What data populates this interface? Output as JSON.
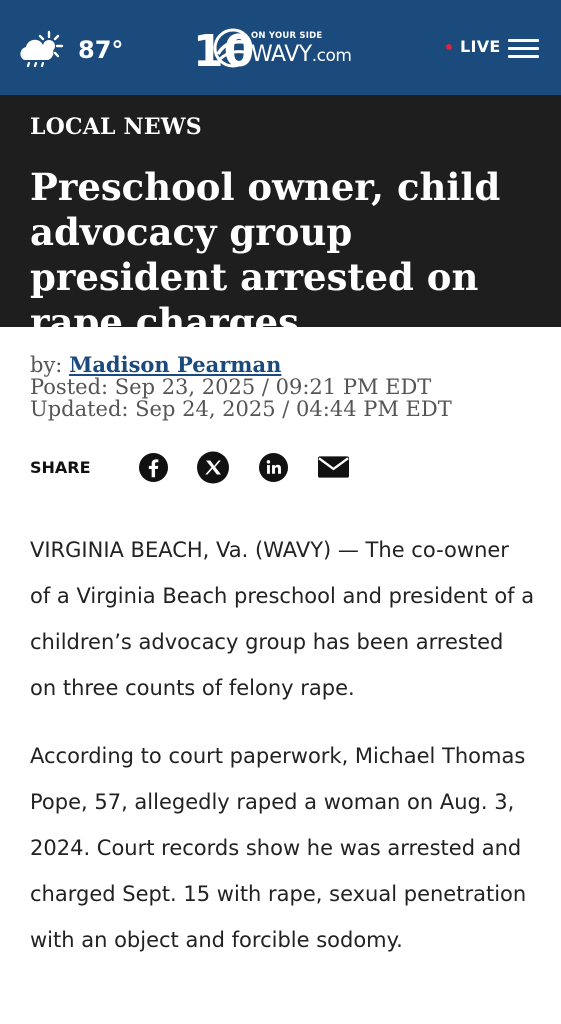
{
  "header": {
    "temperature": "87°",
    "weather_icon": "partly-cloudy-icon",
    "logo": {
      "tagline": "ON YOUR SIDE",
      "brand": "WAVY",
      "suffix": ".com",
      "channel_number": "10"
    },
    "live_label": "LIVE",
    "menu_icon": "hamburger-menu-icon"
  },
  "article": {
    "section": "LOCAL NEWS",
    "headline": "Preschool owner, child advocacy group president arrested on rape charges",
    "byline_prefix": "by:",
    "author": "Madison Pearman",
    "posted": "Posted: Sep 23, 2025 / 09:21 PM EDT",
    "updated": "Updated: Sep 24, 2025 / 04:44 PM EDT",
    "share_label": "SHARE",
    "share_targets": [
      "facebook-icon",
      "x-icon",
      "linkedin-icon",
      "email-icon"
    ],
    "paragraphs": [
      "VIRGINIA BEACH, Va. (WAVY) — The co-owner of a Virginia Beach preschool and president of a children’s advocacy group has been arrested on three counts of felony rape.",
      "According to court paperwork, Michael Thomas Pope, 57, allegedly raped a woman on Aug. 3, 2024. Court records show he was arrested and charged Sept. 15 with rape, sexual penetration with an object and forcible sodomy."
    ]
  },
  "colors": {
    "topbar": "#1b4a7c",
    "hero": "#1e1e1e",
    "link": "#1b4a7c",
    "live_dot": "#d7263d"
  }
}
